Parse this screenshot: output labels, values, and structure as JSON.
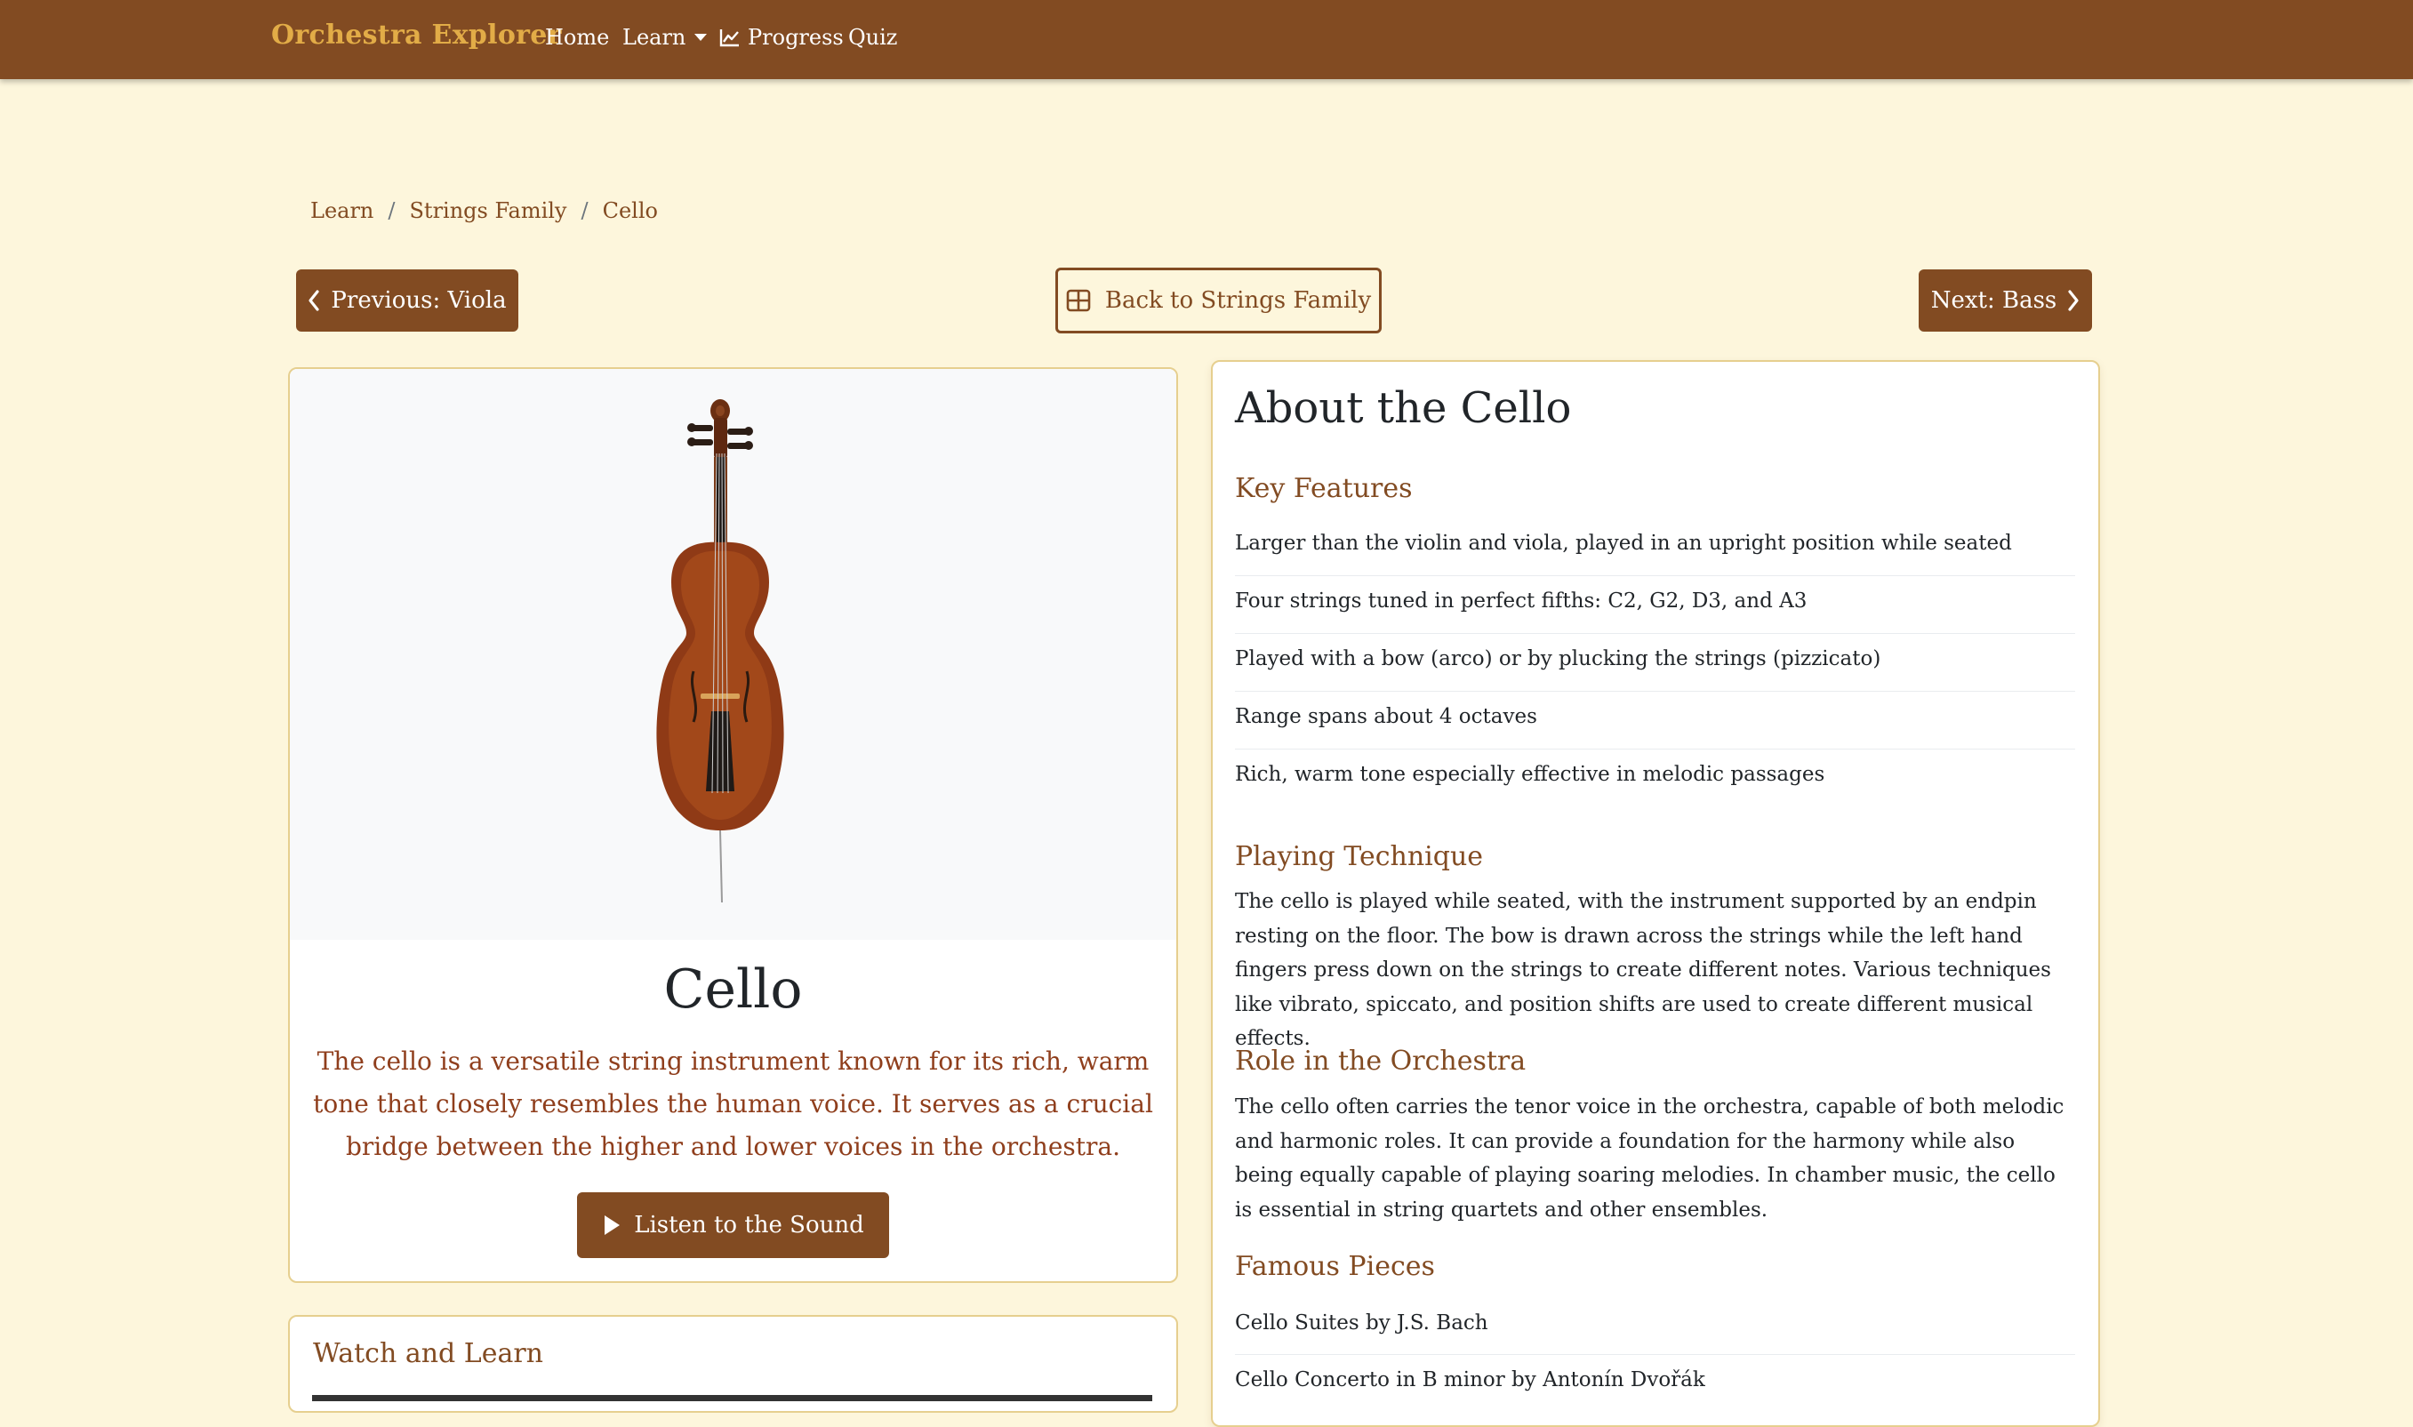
{
  "nav": {
    "brand": "Orchestra Explorer",
    "home": "Home",
    "learn": "Learn",
    "progress": "Progress",
    "quiz": "Quiz"
  },
  "breadcrumb": {
    "items": [
      "Learn",
      "Strings Family",
      "Cello"
    ]
  },
  "buttons": {
    "previous": "Previous: Viola",
    "back": "Back to Strings Family",
    "next": "Next: Bass",
    "listen": "Listen to the Sound"
  },
  "instrument": {
    "name": "Cello",
    "description": "The cello is a versatile string instrument known for its rich, warm tone that closely resembles the human voice. It serves as a crucial bridge between the higher and lower voices in the orchestra."
  },
  "watch": {
    "title": "Watch and Learn"
  },
  "about": {
    "title": "About the Cello",
    "key_features_title": "Key Features",
    "key_features": [
      "Larger than the violin and viola, played in an upright position while seated",
      "Four strings tuned in perfect fifths: C2, G2, D3, and A3",
      "Played with a bow (arco) or by plucking the strings (pizzicato)",
      "Range spans about 4 octaves",
      "Rich, warm tone especially effective in melodic passages"
    ],
    "technique_title": "Playing Technique",
    "technique_text": "The cello is played while seated, with the instrument supported by an endpin resting on the floor. The bow is drawn across the strings while the left hand fingers press down on the strings to create different notes. Various techniques like vibrato, spiccato, and position shifts are used to create different musical effects.",
    "role_title": "Role in the Orchestra",
    "role_text": "The cello often carries the tenor voice in the orchestra, capable of both melodic and harmonic roles. It can provide a foundation for the harmony while also being equally capable of playing soaring melodies. In chamber music, the cello is essential in string quartets and other ensembles.",
    "famous_title": "Famous Pieces",
    "famous_pieces": [
      "Cello Suites by J.S. Bach",
      "Cello Concerto in B minor by Antonín Dvořák"
    ]
  },
  "colors": {
    "navbar": "#824b22",
    "brand": "#e2ac47",
    "background": "#fdf6dc",
    "accent": "#824b22",
    "description_text": "#8f3e1c"
  }
}
